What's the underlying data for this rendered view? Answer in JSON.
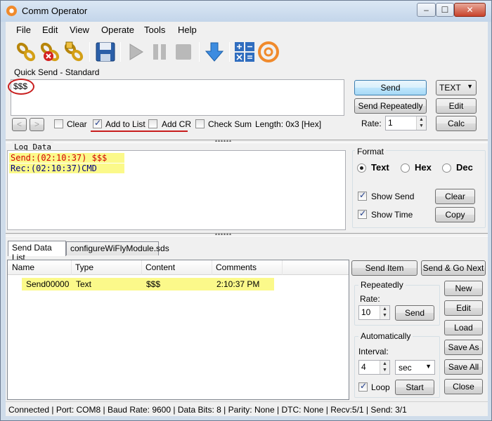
{
  "window": {
    "title": "Comm Operator"
  },
  "menu": {
    "file": "File",
    "edit": "Edit",
    "view": "View",
    "operate": "Operate",
    "tools": "Tools",
    "help": "Help"
  },
  "toolbar": {
    "icons": [
      "chain-connect-icon",
      "chain-disconnect-icon",
      "chain-settings-icon",
      "save-icon",
      "play-icon",
      "pause-icon",
      "stop-icon",
      "download-arrow-icon",
      "calculator-icon",
      "app-logo-icon"
    ]
  },
  "quick_send": {
    "group_label": "Quick Send - Standard",
    "text": "$$$",
    "clear_label": "Clear",
    "clear_checked": false,
    "add_to_list_label": "Add to List",
    "add_to_list_checked": true,
    "add_cr_label": "Add CR",
    "add_cr_checked": false,
    "check_sum_label": "Check Sum",
    "check_sum_checked": false,
    "length_label": "Length: 0x3 [Hex]",
    "send_label": "Send",
    "send_repeatedly_label": "Send Repeatedly",
    "rate_label": "Rate:",
    "rate_value": "1",
    "mode_value": "TEXT",
    "edit_label": "Edit",
    "calc_label": "Calc"
  },
  "log": {
    "group_label": "Log Data",
    "lines": [
      {
        "text": "Send:(02:10:37) $$$",
        "color": "#d40000"
      },
      {
        "text": "Rec:(02:10:37)CMD",
        "color": "#000080"
      }
    ],
    "format_label": "Format",
    "format_options": [
      "Text",
      "Hex",
      "Dec"
    ],
    "format_selected": "Text",
    "show_send_label": "Show Send",
    "show_send_checked": true,
    "show_time_label": "Show Time",
    "show_time_checked": true,
    "clear_label": "Clear",
    "copy_label": "Copy"
  },
  "send_list": {
    "tabs": [
      "Send Data List",
      "configureWiFlyModule.sds"
    ],
    "columns": [
      "Name",
      "Type",
      "Content",
      "Comments"
    ],
    "rows": [
      {
        "name": "Send00000",
        "type": "Text",
        "content": "$$$",
        "comments": "2:10:37 PM"
      }
    ],
    "send_item_label": "Send Item",
    "send_go_next_label": "Send & Go Next",
    "repeatedly_label": "Repeatedly",
    "rate_label": "Rate:",
    "rate_value": "10",
    "repeat_send_label": "Send",
    "automatically_label": "Automatically",
    "interval_label": "Interval:",
    "interval_value": "4",
    "interval_unit": "sec",
    "loop_label": "Loop",
    "loop_checked": true,
    "start_label": "Start",
    "new_label": "New",
    "edit_label": "Edit",
    "load_label": "Load",
    "save_as_label": "Save As",
    "save_all_label": "Save All",
    "close_label": "Close"
  },
  "status": {
    "text": "Connected | Port: COM8 | Baud Rate: 9600 | Data Bits: 8 | Parity: None | DTC: None | Recv:5/1 | Send: 3/1"
  }
}
